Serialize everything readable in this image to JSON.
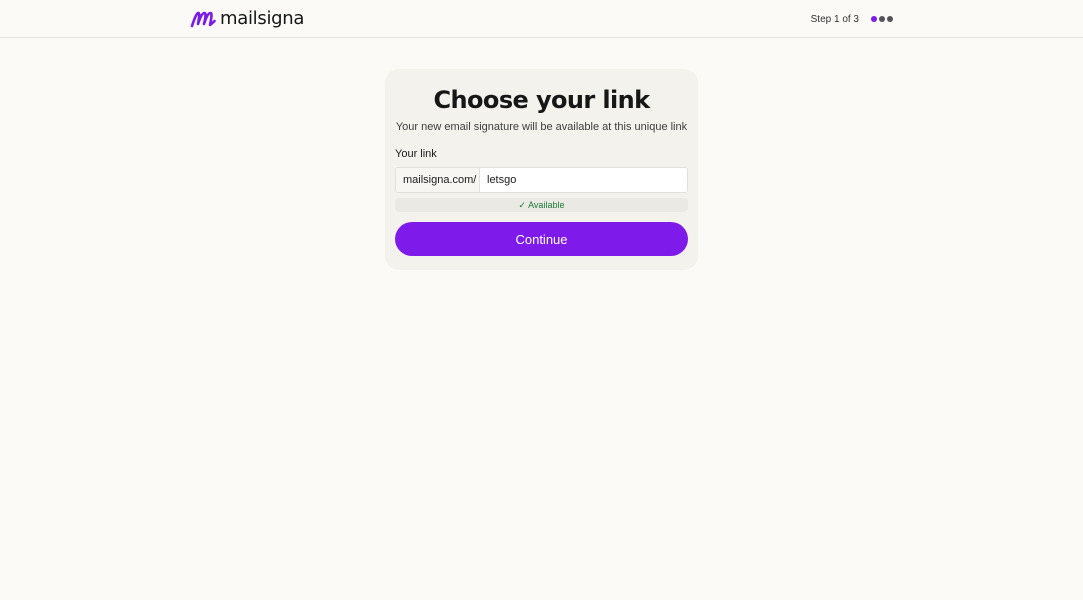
{
  "header": {
    "brand": "mailsigna",
    "logo_icon": "mailsigna-logo-icon",
    "step_text": "Step 1 of 3",
    "steps": {
      "current": 1,
      "total": 3
    },
    "colors": {
      "accent": "#7f1bea",
      "inactive_dot": "#55525a"
    }
  },
  "main": {
    "title": "Choose your link",
    "subtitle": "Your new email signature will be available at this unique link",
    "field_label": "Your link",
    "link_prefix": "mailsigna.com/",
    "link_value": "letsgo",
    "availability": {
      "icon": "check-icon",
      "check": "✓",
      "text": "Available",
      "color": "#1e7a3a"
    },
    "continue_label": "Continue"
  }
}
